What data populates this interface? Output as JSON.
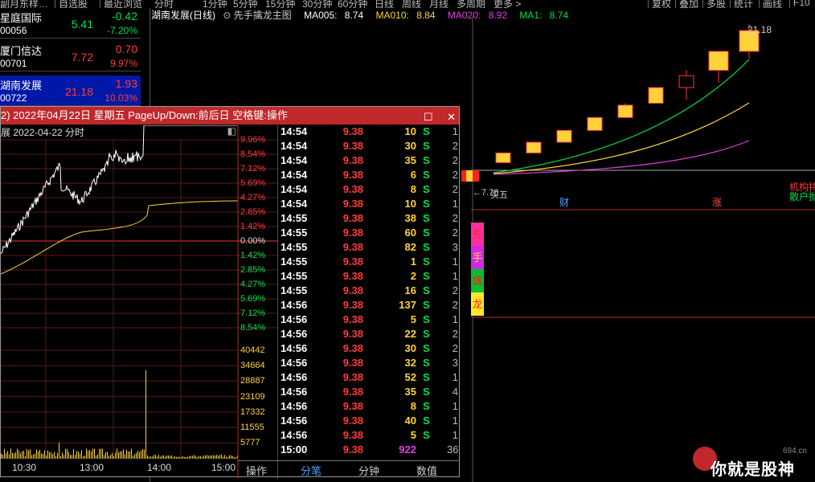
{
  "topbar": {
    "left_tabs": [
      "副月东样…",
      "自选股",
      "最近浏览"
    ],
    "period_tabs": [
      "分时",
      "1分钟",
      "5分钟",
      "15分钟",
      "30分钟",
      "60分钟",
      "日线",
      "周线",
      "月线",
      "多周期",
      "更多 >"
    ],
    "right_buttons": [
      "复权",
      "叠加",
      "多股",
      "统计",
      "画线",
      "F10"
    ]
  },
  "watchlist": [
    {
      "name": "星庭国际",
      "code": "00056",
      "price": "5.41",
      "change": "-0.42",
      "pct": "-7.20%",
      "price_color": "#00e04a",
      "change_color": "#00e04a"
    },
    {
      "name": "厦门信达",
      "code": "00701",
      "price": "7.72",
      "change": "0.70",
      "pct": "9.97%",
      "price_color": "#ff3b3b",
      "change_color": "#ff3b3b"
    },
    {
      "name": "湖南发展",
      "code": "00722",
      "price": "21.18",
      "change": "1.93",
      "pct": "10.03%",
      "price_color": "#ff3b3b",
      "change_color": "#ff3b3b",
      "selected": true
    }
  ],
  "kline": {
    "title": "湖南发展(日线)",
    "indicator": "先手擒龙主图",
    "ma005_label": "MA005:",
    "ma005": "8.74",
    "ma010_label": "MA010:",
    "ma010": "8.84",
    "ma020_label": "MA020:",
    "ma020": "8.92",
    "ma1_label": "MA1:",
    "ma1": "8.74",
    "high_label": "21.18",
    "low_label": "7.76",
    "low_tag": "买五",
    "marker_cai": "财",
    "marker_zhang": "涨",
    "right_label1": "机构持",
    "right_label2": "散户抛",
    "candles": [
      {
        "o": 8.74,
        "c": 9.61,
        "h": 9.61,
        "l": 8.74
      },
      {
        "o": 9.61,
        "c": 10.57,
        "h": 10.57,
        "l": 9.61
      },
      {
        "o": 10.57,
        "c": 11.63,
        "h": 11.63,
        "l": 10.57
      },
      {
        "o": 11.63,
        "c": 12.79,
        "h": 12.79,
        "l": 11.63
      },
      {
        "o": 12.79,
        "c": 13.9,
        "h": 14.07,
        "l": 12.79
      },
      {
        "o": 14.07,
        "c": 15.48,
        "h": 15.48,
        "l": 14.07
      },
      {
        "o": 15.48,
        "c": 16.55,
        "h": 17.03,
        "l": 14.4
      },
      {
        "o": 17.03,
        "c": 18.73,
        "h": 18.73,
        "l": 15.9
      },
      {
        "o": 18.73,
        "c": 20.6,
        "h": 21.18,
        "l": 18.1
      }
    ],
    "side_tags": [
      "先",
      "手",
      "擒",
      "龙"
    ]
  },
  "popup": {
    "title": "2) 2022年04月22日 星期五 PageUp/Down:前后日 空格键:操作",
    "sub_left": "展  2022-04-22 分时",
    "pct_labels": [
      "9.96%",
      "8.54%",
      "7.12%",
      "5.69%",
      "4.27%",
      "2.85%",
      "1.42%",
      "0.00%",
      "1.42%",
      "2.85%",
      "4.27%",
      "5.69%",
      "7.12%",
      "8.54%"
    ],
    "vol_labels": [
      "40442",
      "34664",
      "28887",
      "23109",
      "17332",
      "11555",
      "5777"
    ],
    "time_labels": [
      "10:30",
      "13:00",
      "14:00",
      "15:00"
    ],
    "operate_label": "操作",
    "tabs": [
      "分笔",
      "分钟",
      "数值"
    ],
    "ticks": [
      {
        "t": "14:54",
        "p": "9.38",
        "v": "10",
        "s": "S",
        "n": "1"
      },
      {
        "t": "14:54",
        "p": "9.38",
        "v": "30",
        "s": "S",
        "n": "2"
      },
      {
        "t": "14:54",
        "p": "9.38",
        "v": "35",
        "s": "S",
        "n": "2"
      },
      {
        "t": "14:54",
        "p": "9.38",
        "v": "6",
        "s": "S",
        "n": "2"
      },
      {
        "t": "14:54",
        "p": "9.38",
        "v": "8",
        "s": "S",
        "n": "2"
      },
      {
        "t": "14:54",
        "p": "9.38",
        "v": "10",
        "s": "S",
        "n": "1"
      },
      {
        "t": "14:55",
        "p": "9.38",
        "v": "38",
        "s": "S",
        "n": "2"
      },
      {
        "t": "14:55",
        "p": "9.38",
        "v": "60",
        "s": "S",
        "n": "2"
      },
      {
        "t": "14:55",
        "p": "9.38",
        "v": "82",
        "s": "S",
        "n": "3"
      },
      {
        "t": "14:55",
        "p": "9.38",
        "v": "1",
        "s": "S",
        "n": "1"
      },
      {
        "t": "14:55",
        "p": "9.38",
        "v": "2",
        "s": "S",
        "n": "1"
      },
      {
        "t": "14:55",
        "p": "9.38",
        "v": "16",
        "s": "S",
        "n": "2"
      },
      {
        "t": "14:56",
        "p": "9.38",
        "v": "137",
        "s": "S",
        "n": "2"
      },
      {
        "t": "14:56",
        "p": "9.38",
        "v": "5",
        "s": "S",
        "n": "1"
      },
      {
        "t": "14:56",
        "p": "9.38",
        "v": "22",
        "s": "S",
        "n": "2"
      },
      {
        "t": "14:56",
        "p": "9.38",
        "v": "30",
        "s": "S",
        "n": "2"
      },
      {
        "t": "14:56",
        "p": "9.38",
        "v": "32",
        "s": "S",
        "n": "3"
      },
      {
        "t": "14:56",
        "p": "9.38",
        "v": "52",
        "s": "S",
        "n": "1"
      },
      {
        "t": "14:56",
        "p": "9.38",
        "v": "35",
        "s": "S",
        "n": "4"
      },
      {
        "t": "14:56",
        "p": "9.38",
        "v": "8",
        "s": "S",
        "n": "1"
      },
      {
        "t": "14:56",
        "p": "9.38",
        "v": "40",
        "s": "S",
        "n": "1"
      },
      {
        "t": "14:56",
        "p": "9.38",
        "v": "5",
        "s": "S",
        "n": "1"
      },
      {
        "t": "15:00",
        "p": "9.38",
        "v": "922",
        "s": "",
        "n": "36"
      }
    ]
  },
  "logo": {
    "domain": "694.cn",
    "text": "你就是股神"
  },
  "colors": {
    "up": "#ff3b3b",
    "down": "#00e04a",
    "popup_title": "#c0282c",
    "selected_row": "#0018a8"
  }
}
